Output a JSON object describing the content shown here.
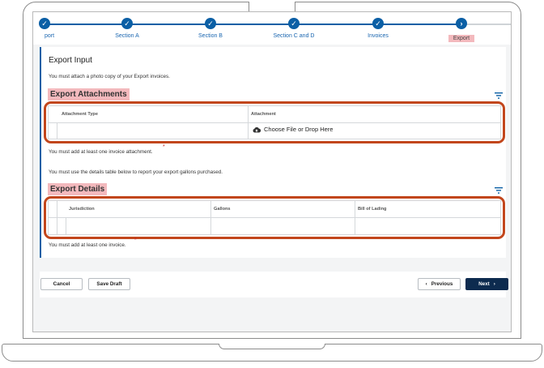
{
  "stepper": {
    "steps": [
      {
        "label": "port",
        "state": "done"
      },
      {
        "label": "Section A",
        "state": "done"
      },
      {
        "label": "Section B",
        "state": "done"
      },
      {
        "label": "Section C and D",
        "state": "done"
      },
      {
        "label": "Invoices",
        "state": "done"
      },
      {
        "label": "Export",
        "state": "current"
      }
    ],
    "done_glyph": "✓",
    "current_glyph": "›"
  },
  "page": {
    "title": "Export Input",
    "intro": "You must attach a photo copy of your Export invoices."
  },
  "attachments": {
    "section_title": "Export Attachments",
    "columns": [
      "Attachment Type",
      "Attachment"
    ],
    "upload_label": "Choose File or Drop Here",
    "upload_icon": "cloud-upload-icon",
    "requirement": "You must add at least one invoice attachment.",
    "required_mark": "*"
  },
  "details_intro": "You must use the details table below to report your export gallons purchased.",
  "details": {
    "section_title": "Export Details",
    "columns": [
      "Jurisdiction",
      "Gallons",
      "Bill of Lading"
    ],
    "requirement": "You must add at least one invoice.",
    "required_mark": "*"
  },
  "buttons": {
    "cancel": "Cancel",
    "save_draft": "Save Draft",
    "previous": "Previous",
    "next": "Next"
  },
  "colors": {
    "accent": "#0b5fa5",
    "primary_button": "#0d2b4f",
    "highlight_label": "#f3b9bd",
    "annotation_outline": "#c2461c",
    "required": "#c62828"
  }
}
